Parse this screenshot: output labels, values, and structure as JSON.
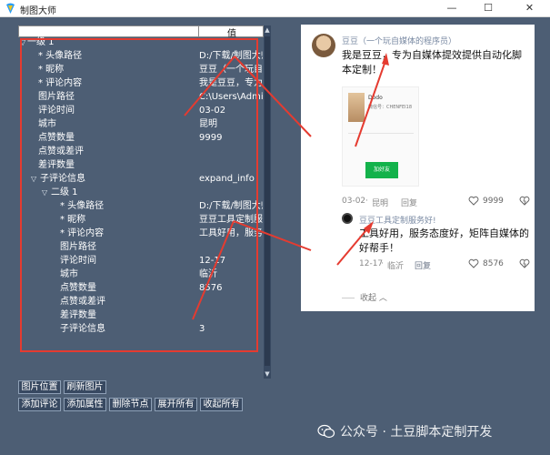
{
  "window": {
    "title": "制图大师",
    "minimize": "—",
    "maximize": "☐",
    "close": "✕"
  },
  "tree": {
    "header_value": "值",
    "rows": [
      {
        "indent": 0,
        "toggle": "▽",
        "label": "一级 1",
        "value": ""
      },
      {
        "indent": 1,
        "toggle": "",
        "label": "* 头像路径",
        "value": "D:/下载/制图大师"
      },
      {
        "indent": 1,
        "toggle": "",
        "label": "* 昵称",
        "value": "豆豆（一个玩自"
      },
      {
        "indent": 1,
        "toggle": "",
        "label": "* 评论内容",
        "value": "我是豆豆，专为"
      },
      {
        "indent": 1,
        "toggle": "",
        "label": "图片路径",
        "value": "C:\\Users\\Admini"
      },
      {
        "indent": 1,
        "toggle": "",
        "label": "评论时间",
        "value": "03-02"
      },
      {
        "indent": 1,
        "toggle": "",
        "label": "城市",
        "value": "昆明"
      },
      {
        "indent": 1,
        "toggle": "",
        "label": "点赞数量",
        "value": "9999"
      },
      {
        "indent": 1,
        "toggle": "",
        "label": "点赞或差评",
        "value": ""
      },
      {
        "indent": 1,
        "toggle": "",
        "label": "差评数量",
        "value": ""
      },
      {
        "indent": 1,
        "toggle": "▽",
        "label": "子评论信息",
        "value": "expand_info"
      },
      {
        "indent": 2,
        "toggle": "▽",
        "label": "二级 1",
        "value": ""
      },
      {
        "indent": 3,
        "toggle": "",
        "label": "* 头像路径",
        "value": "D:/下载/制图大师"
      },
      {
        "indent": 3,
        "toggle": "",
        "label": "* 昵称",
        "value": "豆豆工具定制服"
      },
      {
        "indent": 3,
        "toggle": "",
        "label": "* 评论内容",
        "value": "工具好用，服务"
      },
      {
        "indent": 3,
        "toggle": "",
        "label": "图片路径",
        "value": ""
      },
      {
        "indent": 3,
        "toggle": "",
        "label": "评论时间",
        "value": "12-17"
      },
      {
        "indent": 3,
        "toggle": "",
        "label": "城市",
        "value": "临沂"
      },
      {
        "indent": 3,
        "toggle": "",
        "label": "点赞数量",
        "value": "8576"
      },
      {
        "indent": 3,
        "toggle": "",
        "label": "点赞或差评",
        "value": ""
      },
      {
        "indent": 3,
        "toggle": "",
        "label": "差评数量",
        "value": ""
      },
      {
        "indent": 3,
        "toggle": "",
        "label": "子评论信息",
        "value": "3"
      }
    ]
  },
  "buttons": {
    "image_position": "图片位置",
    "refresh_image": "刷新图片",
    "add_comment": "添加评论",
    "add_attribute": "添加属性",
    "delete_node": "删除节点",
    "expand_all": "展开所有",
    "collapse_all": "收起所有"
  },
  "preview": {
    "username": "豆豆（一个玩自媒体的程序员）",
    "content": "我是豆豆，专为自媒体提效提供自动化脚本定制！",
    "thumb_name": "Dodo",
    "thumb_id": "微信号：CHENFEI18",
    "thumb_button": "加好友",
    "date": "03-02",
    "city": "昆明",
    "reply": "回复",
    "likes": "9999",
    "sub_username": "豆豆工具定制服务好!",
    "sub_content": "工具好用，服务态度好，矩阵自媒体的好帮手！",
    "sub_date": "12-17",
    "sub_city": "临沂",
    "sub_likes": "8576",
    "collapse": "收起"
  },
  "watermark": "公众号 · 土豆脚本定制开发",
  "colors": {
    "background": "#4d5e74",
    "highlight_red": "#e53b30",
    "card": "#ffffff"
  }
}
